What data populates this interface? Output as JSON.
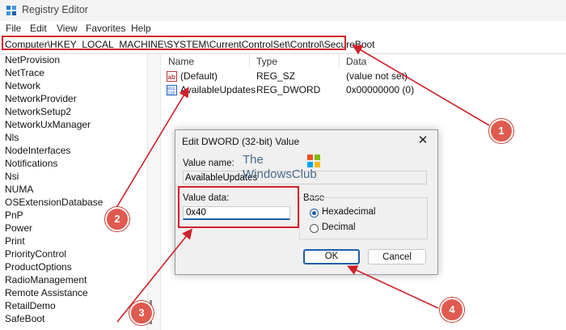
{
  "window": {
    "title": "Registry Editor"
  },
  "menu": [
    "File",
    "Edit",
    "View",
    "Favorites",
    "Help"
  ],
  "address": {
    "path": "Computer\\HKEY_LOCAL_MACHINE\\SYSTEM\\CurrentControlSet\\Control\\SecureBoot"
  },
  "tree": {
    "items": [
      "NetProvision",
      "NetTrace",
      "Network",
      "NetworkProvider",
      "NetworkSetup2",
      "NetworkUxManager",
      "Nls",
      "NodeInterfaces",
      "Notifications",
      "Nsi",
      "NUMA",
      "OSExtensionDatabase",
      "PnP",
      "Power",
      "Print",
      "PriorityControl",
      "ProductOptions",
      "RadioManagement",
      "Remote Assistance",
      "RetailDemo",
      "SafeBoot"
    ]
  },
  "values": {
    "columns": {
      "name": "Name",
      "type": "Type",
      "data": "Data"
    },
    "rows": [
      {
        "name": "(Default)",
        "type": "REG_SZ",
        "data": "(value not set)",
        "icon": "string-value-icon"
      },
      {
        "name": "AvailableUpdates",
        "type": "REG_DWORD",
        "data": "0x00000000 (0)",
        "icon": "dword-value-icon"
      }
    ]
  },
  "dialog": {
    "title": "Edit DWORD (32-bit) Value",
    "close": "✕",
    "value_name_label": "Value name:",
    "value_name": "AvailableUpdates",
    "value_data_label": "Value data:",
    "value_data": "0x40",
    "base_label": "Base",
    "base_options": [
      {
        "label": "Hexadecimal",
        "selected": true
      },
      {
        "label": "Decimal",
        "selected": false
      }
    ],
    "ok_label": "OK",
    "cancel_label": "Cancel"
  },
  "watermark": {
    "line1": "The",
    "line2": "WindowsClub"
  },
  "callouts": [
    "1",
    "2",
    "3",
    "4"
  ],
  "colors": {
    "callout": "#e05a4f",
    "highlight": "#d0202a",
    "accent": "#1f5fa8"
  }
}
